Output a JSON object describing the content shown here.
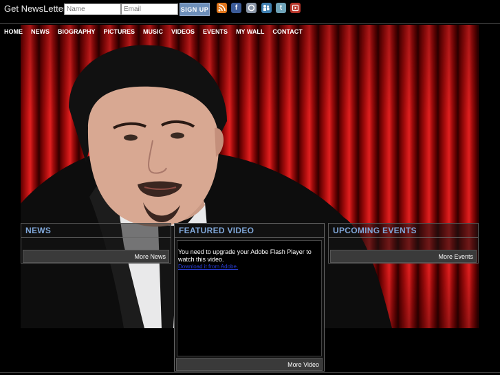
{
  "header": {
    "newsletter_label": "Get NewsLetters",
    "name_placeholder": "Name",
    "email_placeholder": "Email",
    "signup_label": "SIGN UP",
    "social_icons": [
      "rss-icon",
      "facebook-icon",
      "google-icon",
      "myspace-icon",
      "twitter-icon",
      "youtube-icon"
    ]
  },
  "nav": {
    "items": [
      "HOME",
      "NEWS",
      "BIOGRAPHY",
      "PICTURES",
      "MUSIC",
      "VIDEOS",
      "EVENTS",
      "MY WALL",
      "CONTACT"
    ]
  },
  "news": {
    "title": "NEWS",
    "more_label": "More News"
  },
  "featured_video": {
    "title": "FEATURED VIDEO",
    "flash_message": "You need to upgrade your Adobe Flash Player to watch this video.",
    "download_link": "Download it from Adobe.",
    "more_label": "More Video"
  },
  "events": {
    "title": "UPCOMING EVENTS",
    "more_label": "More Events"
  },
  "colors": {
    "accent_title": "#7fa6d8",
    "curtain_red": "#c81616",
    "signup_blue": "#6d8fba"
  }
}
